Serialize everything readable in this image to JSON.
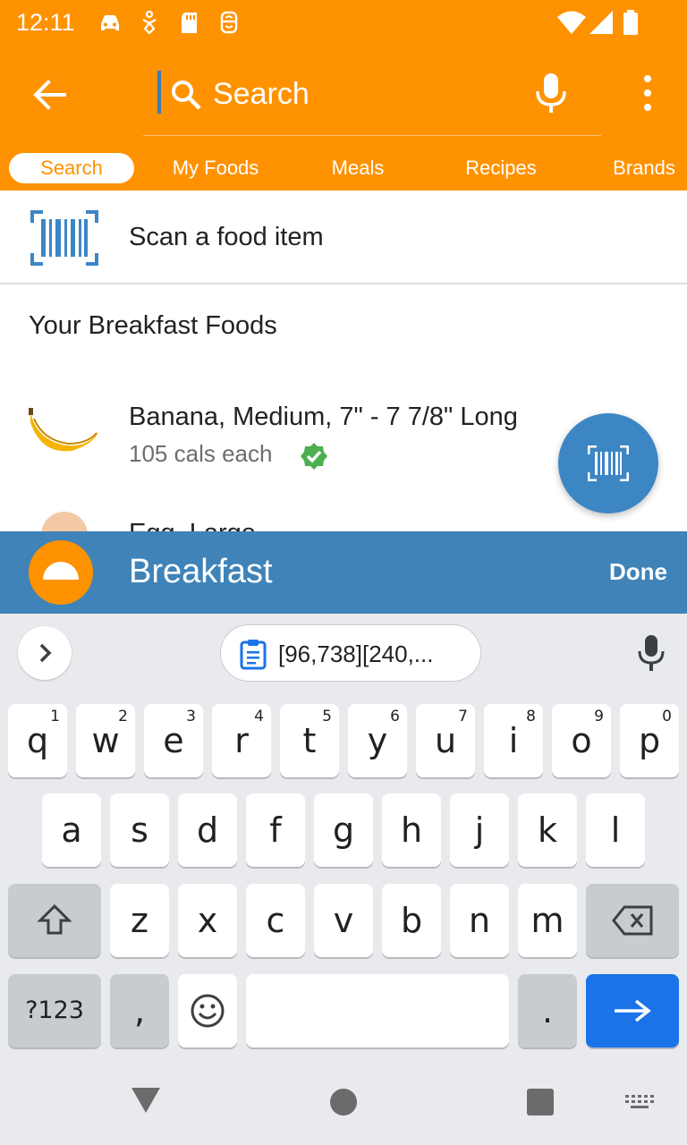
{
  "status_bar": {
    "time": "12:11",
    "left_icons": [
      "car-icon",
      "accessibility-icon",
      "sd-card-icon",
      "sync-icon"
    ],
    "right_icons": [
      "wifi-icon",
      "signal-icon",
      "battery-icon"
    ]
  },
  "app_bar": {
    "search_placeholder": "Search",
    "icons": [
      "back-arrow-icon",
      "search-icon",
      "mic-icon",
      "more-vert-icon"
    ]
  },
  "tabs": [
    {
      "label": "Search",
      "active": true
    },
    {
      "label": "My Foods",
      "active": false
    },
    {
      "label": "Meals",
      "active": false
    },
    {
      "label": "Recipes",
      "active": false
    },
    {
      "label": "Brands",
      "active": false
    }
  ],
  "scan": {
    "label": "Scan a food item"
  },
  "section_title": "Your Breakfast Foods",
  "foods": [
    {
      "name": "Banana, Medium, 7\" - 7 7/8\" Long",
      "cals": "105 cals each",
      "verified": true
    },
    {
      "name": "Egg, Large",
      "cals": ""
    }
  ],
  "meal_bar": {
    "label": "Breakfast",
    "done": "Done"
  },
  "keyboard": {
    "clipboard_text": "[96,738][240,...",
    "row1": [
      {
        "k": "q",
        "n": "1"
      },
      {
        "k": "w",
        "n": "2"
      },
      {
        "k": "e",
        "n": "3"
      },
      {
        "k": "r",
        "n": "4"
      },
      {
        "k": "t",
        "n": "5"
      },
      {
        "k": "y",
        "n": "6"
      },
      {
        "k": "u",
        "n": "7"
      },
      {
        "k": "i",
        "n": "8"
      },
      {
        "k": "o",
        "n": "9"
      },
      {
        "k": "p",
        "n": "0"
      }
    ],
    "row2": [
      "a",
      "s",
      "d",
      "f",
      "g",
      "h",
      "j",
      "k",
      "l"
    ],
    "row3": [
      "z",
      "x",
      "c",
      "v",
      "b",
      "n",
      "m"
    ],
    "symbols_label": "?123",
    "comma": ",",
    "period": "."
  },
  "colors": {
    "brand_orange": "#ff9200",
    "meal_blue": "#3f83b8",
    "fab_blue": "#3d86c4",
    "key_blue": "#1a73e8",
    "verified_green": "#4caf50"
  }
}
